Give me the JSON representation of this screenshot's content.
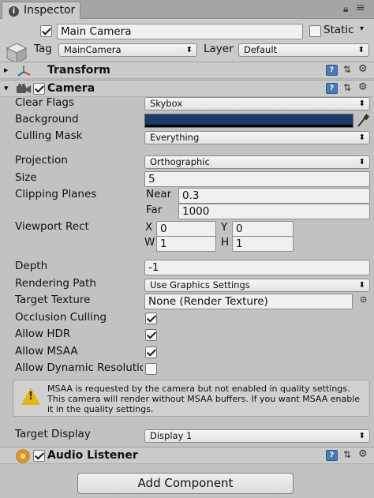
{
  "tab": {
    "label": "Inspector"
  },
  "object": {
    "name": "Main Camera",
    "static_label": "Static",
    "tag_label": "Tag",
    "tag_value": "MainCamera",
    "layer_label": "Layer",
    "layer_value": "Default"
  },
  "transform": {
    "title": "Transform"
  },
  "camera": {
    "title": "Camera",
    "clear_flags": {
      "label": "Clear Flags",
      "value": "Skybox"
    },
    "background": {
      "label": "Background",
      "color": "#1c3a67"
    },
    "culling_mask": {
      "label": "Culling Mask",
      "value": "Everything"
    },
    "projection": {
      "label": "Projection",
      "value": "Orthographic"
    },
    "size": {
      "label": "Size",
      "value": "5"
    },
    "clipping": {
      "label": "Clipping Planes",
      "near_label": "Near",
      "near_value": "0.3",
      "far_label": "Far",
      "far_value": "1000"
    },
    "viewport": {
      "label": "Viewport Rect",
      "x_label": "X",
      "x_value": "0",
      "y_label": "Y",
      "y_value": "0",
      "w_label": "W",
      "w_value": "1",
      "h_label": "H",
      "h_value": "1"
    },
    "depth": {
      "label": "Depth",
      "value": "-1"
    },
    "rendering_path": {
      "label": "Rendering Path",
      "value": "Use Graphics Settings"
    },
    "target_texture": {
      "label": "Target Texture",
      "value": "None (Render Texture)"
    },
    "occlusion_culling": {
      "label": "Occlusion Culling",
      "checked": true
    },
    "allow_hdr": {
      "label": "Allow HDR",
      "checked": true
    },
    "allow_msaa": {
      "label": "Allow MSAA",
      "checked": true
    },
    "allow_dynamic": {
      "label": "Allow Dynamic Resolutio",
      "checked": false
    },
    "warning": "MSAA is requested by the camera but not enabled in quality settings. This camera will render without MSAA buffers. If you want MSAA enable it in the quality settings.",
    "target_display": {
      "label": "Target Display",
      "value": "Display 1"
    }
  },
  "audio_listener": {
    "title": "Audio Listener"
  },
  "add_component": {
    "label": "Add Component"
  },
  "colors": {
    "accent_blue": "#4c7ab8",
    "warning_yellow": "#e5b714",
    "panel_bg": "#c2c2c2"
  }
}
